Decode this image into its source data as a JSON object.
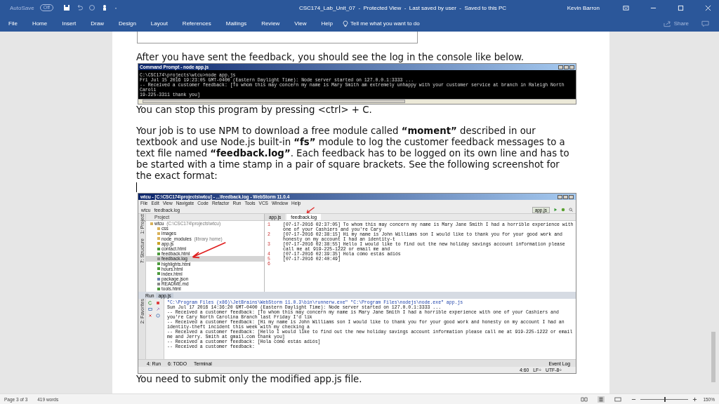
{
  "title_bar": {
    "autosave": {
      "label": "AutoSave",
      "state_label": "Off",
      "on": false
    },
    "title": "CSC174_Lab_Unit_07  -  Protected View  -  Last saved by user  -  Saved to this PC",
    "user": "Kevin Barron"
  },
  "ribbon": {
    "tabs": [
      {
        "label": "File",
        "selected": false
      },
      {
        "label": "Home",
        "selected": false
      },
      {
        "label": "Insert",
        "selected": false
      },
      {
        "label": "Draw",
        "selected": false
      },
      {
        "label": "Design",
        "selected": false
      },
      {
        "label": "Layout",
        "selected": false
      },
      {
        "label": "References",
        "selected": false
      },
      {
        "label": "Mailings",
        "selected": false
      },
      {
        "label": "Review",
        "selected": false
      },
      {
        "label": "View",
        "selected": false
      },
      {
        "label": "Help",
        "selected": false
      }
    ],
    "tell_me": "Tell me what you want to do",
    "share": "Share"
  },
  "document": {
    "intro": "After you have sent the feedback, you should see the log in the console like below.",
    "console": {
      "title": "Command Prompt - node  app.js",
      "lines": [
        "C:\\CSC174\\projects\\wtcu>node app.js",
        "Fri Jul 15 2016 19:23:05 GMT-0400 (Eastern Daylight Time): Node server started on 127.0.0.1:3333 ...",
        "-- Received a customer feedback: [To whom this may concern my name is Mary Smith am extremely unhappy with your customer service at branch in Raleigh North Caroli",
        "19-225-3311 thank you]"
      ]
    },
    "stop_note": "You can stop this program by pressing <ctrl> + C.",
    "task": "Your job is to use NPM to download a free module called **“moment”** described in our textbook and use Node.js built-in **“fs”** module to log the customer feedback messages to a text file named **“feedback.log”**. Each feedback has to be logged on its own line and has to be started with a time stamp in a pair of square brackets. See the following screenshot for the exact format:",
    "ide": {
      "title": "wtcu - [C:\\CSC174\\projects\\wtcu] - ...\\feedback.log - WebStorm 11.0.4",
      "menu": [
        "File",
        "Edit",
        "View",
        "Navigate",
        "Code",
        "Refactor",
        "Run",
        "Tools",
        "VCS",
        "Window",
        "Help"
      ],
      "breadcrumbs": [
        "wtcu",
        "feedback.log"
      ],
      "run_config": "app.js",
      "side_tools": [
        "1: Project",
        "7: Structure"
      ],
      "favorites": "2: Favorites",
      "project_header": "Project",
      "tree": {
        "name": "wtcu",
        "path": "(C:\\CSC174\\projects\\wtcu)",
        "kind": "folder",
        "selected": false,
        "children": [
          {
            "name": "css",
            "kind": "folder",
            "selected": false
          },
          {
            "name": "images",
            "kind": "folder",
            "selected": false
          },
          {
            "name": "node_modules",
            "path": "(library home)",
            "kind": "folder",
            "selected": false
          },
          {
            "name": "app.js",
            "kind": "js",
            "selected": false
          },
          {
            "name": "contact.html",
            "kind": "html",
            "selected": false
          },
          {
            "name": "feedback.html",
            "kind": "html",
            "selected": false
          },
          {
            "name": "feedback.log",
            "kind": "text",
            "selected": true
          },
          {
            "name": "highlights.html",
            "kind": "html",
            "selected": false
          },
          {
            "name": "hours.html",
            "kind": "html",
            "selected": false
          },
          {
            "name": "index.html",
            "kind": "html",
            "selected": false
          },
          {
            "name": "package.json",
            "kind": "json",
            "selected": false
          },
          {
            "name": "README.md",
            "kind": "text",
            "selected": false
          },
          {
            "name": "tools.html",
            "kind": "html",
            "selected": false
          }
        ]
      },
      "tabs": [
        {
          "label": "app.js",
          "selected": false
        },
        {
          "label": "feedback.log",
          "selected": true
        }
      ],
      "editor_lines": [
        {
          "number": "1",
          "text": "[07-17-2016 02:37:05] To whom this may concern my name is Mary Jane Smith I had a horrible experience with one of your Cashiers and you're Cary"
        },
        {
          "number": "2",
          "text": "[07-17-2016 02:38:15] Hi my name is John Williams son I would like to thank you for your good work and honesty on my account I had an identity-t"
        },
        {
          "number": "3",
          "text": "[07-17-2016 02:38:55] Hello I would like to find out the new holiday savings account information please call me at 919-225-1222 or email me and"
        },
        {
          "number": "4",
          "text": "[07-17-2016 02:39:35] Hola cómo estás adiós"
        },
        {
          "number": "5",
          "text": "[07-17-2016 02:40:49]"
        },
        {
          "number": "6"
        }
      ],
      "run_title": "Run",
      "run_tab": "app.js",
      "run_lines": [
        "\"C:\\Program Files (x86)\\JetBrains\\WebStorm 11.0.3\\bin\\runnerw.exe\" \"C:\\Program Files\\nodejs\\node.exe\" app.js",
        "Sun Jul 17 2016 14:36:20 GMT-0400 (Eastern Daylight Time): Node server started on 127.0.0.1:3333 ...",
        "-- Received a customer feedback: [To whom this may concern my name is Mary Jane Smith I had a horrible experience with one of your Cashiers and you're Cary North Carolina Branch last Friday I'd lik",
        "-- Received a customer feedback: [Hi my name is John Williams son I would like to thank you for your good work and honesty on my account I had an identity-theft incident this week with my checking a",
        "-- Received a customer feedback: [Hello I would like to find out the new holiday savings account information please call me at 919-225-1222 or email me and Jerry. Smith at gmail.com thank you]",
        "-- Received a customer feedback: [Hola cómo estás adiós]",
        "-- Received a customer feedback:"
      ],
      "bottom_tabs": [
        "4: Run",
        "6: TODO",
        "Terminal"
      ],
      "event_log": "Event Log",
      "status": [
        "4:60",
        "LF÷",
        "UTF-8÷"
      ]
    },
    "last_line": "You need to submit only the modified app.js file."
  },
  "status_bar": {
    "page": "Page 3 of 3",
    "words": "419 words",
    "zoom": "150%",
    "zoom_level": {
      "level": 0.5
    }
  }
}
